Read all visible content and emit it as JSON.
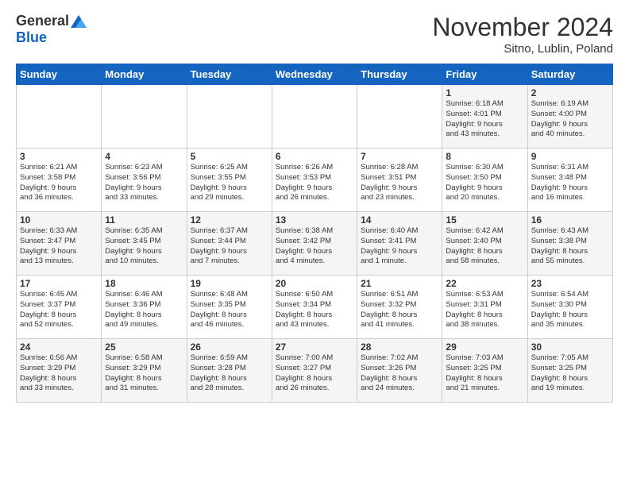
{
  "header": {
    "logo_general": "General",
    "logo_blue": "Blue",
    "month_title": "November 2024",
    "location": "Sitno, Lublin, Poland"
  },
  "weekdays": [
    "Sunday",
    "Monday",
    "Tuesday",
    "Wednesday",
    "Thursday",
    "Friday",
    "Saturday"
  ],
  "weeks": [
    [
      {
        "day": "",
        "info": ""
      },
      {
        "day": "",
        "info": ""
      },
      {
        "day": "",
        "info": ""
      },
      {
        "day": "",
        "info": ""
      },
      {
        "day": "",
        "info": ""
      },
      {
        "day": "1",
        "info": "Sunrise: 6:18 AM\nSunset: 4:01 PM\nDaylight: 9 hours\nand 43 minutes."
      },
      {
        "day": "2",
        "info": "Sunrise: 6:19 AM\nSunset: 4:00 PM\nDaylight: 9 hours\nand 40 minutes."
      }
    ],
    [
      {
        "day": "3",
        "info": "Sunrise: 6:21 AM\nSunset: 3:58 PM\nDaylight: 9 hours\nand 36 minutes."
      },
      {
        "day": "4",
        "info": "Sunrise: 6:23 AM\nSunset: 3:56 PM\nDaylight: 9 hours\nand 33 minutes."
      },
      {
        "day": "5",
        "info": "Sunrise: 6:25 AM\nSunset: 3:55 PM\nDaylight: 9 hours\nand 29 minutes."
      },
      {
        "day": "6",
        "info": "Sunrise: 6:26 AM\nSunset: 3:53 PM\nDaylight: 9 hours\nand 26 minutes."
      },
      {
        "day": "7",
        "info": "Sunrise: 6:28 AM\nSunset: 3:51 PM\nDaylight: 9 hours\nand 23 minutes."
      },
      {
        "day": "8",
        "info": "Sunrise: 6:30 AM\nSunset: 3:50 PM\nDaylight: 9 hours\nand 20 minutes."
      },
      {
        "day": "9",
        "info": "Sunrise: 6:31 AM\nSunset: 3:48 PM\nDaylight: 9 hours\nand 16 minutes."
      }
    ],
    [
      {
        "day": "10",
        "info": "Sunrise: 6:33 AM\nSunset: 3:47 PM\nDaylight: 9 hours\nand 13 minutes."
      },
      {
        "day": "11",
        "info": "Sunrise: 6:35 AM\nSunset: 3:45 PM\nDaylight: 9 hours\nand 10 minutes."
      },
      {
        "day": "12",
        "info": "Sunrise: 6:37 AM\nSunset: 3:44 PM\nDaylight: 9 hours\nand 7 minutes."
      },
      {
        "day": "13",
        "info": "Sunrise: 6:38 AM\nSunset: 3:42 PM\nDaylight: 9 hours\nand 4 minutes."
      },
      {
        "day": "14",
        "info": "Sunrise: 6:40 AM\nSunset: 3:41 PM\nDaylight: 9 hours\nand 1 minute."
      },
      {
        "day": "15",
        "info": "Sunrise: 6:42 AM\nSunset: 3:40 PM\nDaylight: 8 hours\nand 58 minutes."
      },
      {
        "day": "16",
        "info": "Sunrise: 6:43 AM\nSunset: 3:38 PM\nDaylight: 8 hours\nand 55 minutes."
      }
    ],
    [
      {
        "day": "17",
        "info": "Sunrise: 6:45 AM\nSunset: 3:37 PM\nDaylight: 8 hours\nand 52 minutes."
      },
      {
        "day": "18",
        "info": "Sunrise: 6:46 AM\nSunset: 3:36 PM\nDaylight: 8 hours\nand 49 minutes."
      },
      {
        "day": "19",
        "info": "Sunrise: 6:48 AM\nSunset: 3:35 PM\nDaylight: 8 hours\nand 46 minutes."
      },
      {
        "day": "20",
        "info": "Sunrise: 6:50 AM\nSunset: 3:34 PM\nDaylight: 8 hours\nand 43 minutes."
      },
      {
        "day": "21",
        "info": "Sunrise: 6:51 AM\nSunset: 3:32 PM\nDaylight: 8 hours\nand 41 minutes."
      },
      {
        "day": "22",
        "info": "Sunrise: 6:53 AM\nSunset: 3:31 PM\nDaylight: 8 hours\nand 38 minutes."
      },
      {
        "day": "23",
        "info": "Sunrise: 6:54 AM\nSunset: 3:30 PM\nDaylight: 8 hours\nand 35 minutes."
      }
    ],
    [
      {
        "day": "24",
        "info": "Sunrise: 6:56 AM\nSunset: 3:29 PM\nDaylight: 8 hours\nand 33 minutes."
      },
      {
        "day": "25",
        "info": "Sunrise: 6:58 AM\nSunset: 3:29 PM\nDaylight: 8 hours\nand 31 minutes."
      },
      {
        "day": "26",
        "info": "Sunrise: 6:59 AM\nSunset: 3:28 PM\nDaylight: 8 hours\nand 28 minutes."
      },
      {
        "day": "27",
        "info": "Sunrise: 7:00 AM\nSunset: 3:27 PM\nDaylight: 8 hours\nand 26 minutes."
      },
      {
        "day": "28",
        "info": "Sunrise: 7:02 AM\nSunset: 3:26 PM\nDaylight: 8 hours\nand 24 minutes."
      },
      {
        "day": "29",
        "info": "Sunrise: 7:03 AM\nSunset: 3:25 PM\nDaylight: 8 hours\nand 21 minutes."
      },
      {
        "day": "30",
        "info": "Sunrise: 7:05 AM\nSunset: 3:25 PM\nDaylight: 8 hours\nand 19 minutes."
      }
    ]
  ]
}
